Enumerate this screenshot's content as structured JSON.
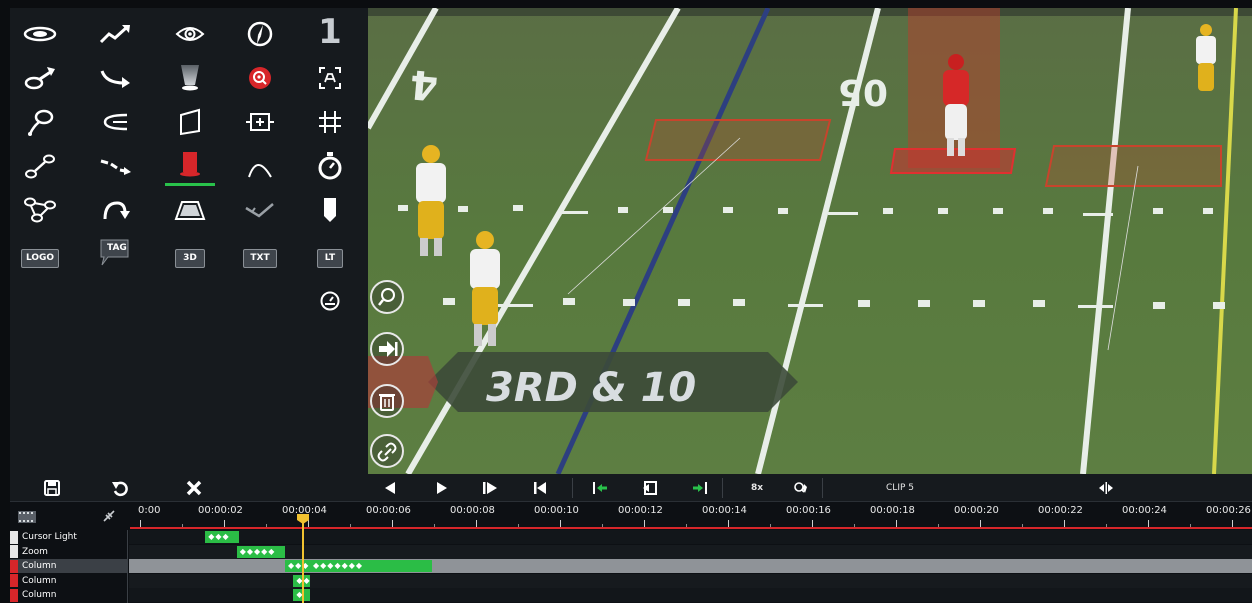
{
  "palette": {
    "tools": [
      {
        "name": "ellipse-spotlight-icon",
        "col": 0,
        "row": 0
      },
      {
        "name": "arrow-zigzag-icon",
        "col": 1,
        "row": 0
      },
      {
        "name": "eye-icon",
        "col": 2,
        "row": 0
      },
      {
        "name": "compass-icon",
        "col": 3,
        "row": 0
      },
      {
        "name": "number-one-icon",
        "col": 4,
        "row": 0
      },
      {
        "name": "ellipse-arrow-icon",
        "col": 0,
        "row": 1
      },
      {
        "name": "curved-arrow-icon",
        "col": 1,
        "row": 1
      },
      {
        "name": "cone-light-icon",
        "col": 2,
        "row": 1
      },
      {
        "name": "target-zoom-icon",
        "col": 3,
        "row": 1
      },
      {
        "name": "focus-frame-icon",
        "col": 4,
        "row": 1
      },
      {
        "name": "pin-marker-icon",
        "col": 0,
        "row": 2
      },
      {
        "name": "backward-arrow-icon",
        "col": 1,
        "row": 2
      },
      {
        "name": "plane-icon",
        "col": 2,
        "row": 2
      },
      {
        "name": "zoom-box-icon",
        "col": 3,
        "row": 2
      },
      {
        "name": "grid-icon",
        "col": 4,
        "row": 2
      },
      {
        "name": "connector-icon",
        "col": 0,
        "row": 3
      },
      {
        "name": "dashed-arrow-icon",
        "col": 1,
        "row": 3
      },
      {
        "name": "column-highlight-icon",
        "col": 2,
        "row": 3
      },
      {
        "name": "curve-line-icon",
        "col": 3,
        "row": 3
      },
      {
        "name": "stopwatch-icon",
        "col": 4,
        "row": 3
      },
      {
        "name": "triangle-nodes-icon",
        "col": 0,
        "row": 4
      },
      {
        "name": "rotate-arrow-icon",
        "col": 1,
        "row": 4
      },
      {
        "name": "floor-zone-icon",
        "col": 2,
        "row": 4
      },
      {
        "name": "angle-icon",
        "col": 3,
        "row": 4
      },
      {
        "name": "bookmark-icon",
        "col": 4,
        "row": 4
      }
    ],
    "labels": {
      "logo": "LOGO",
      "tag": "TAG",
      "three_d": "3D",
      "txt": "TXT",
      "lt": "LT"
    },
    "number_tool": "1",
    "speedometer": "speedometer-icon",
    "active_tool": "column-highlight-icon",
    "active_color": "#29c24b"
  },
  "video": {
    "down_distance": "3RD & 10",
    "yard_number_left": "4",
    "yard_number_top": "05",
    "side_buttons": [
      "magnifier-icon",
      "next-icon",
      "trash-icon",
      "link-icon"
    ]
  },
  "controls": {
    "save": "save-icon",
    "undo": "undo-icon",
    "close": "close-icon",
    "speed": "8x",
    "clip_label": "CLIP 5"
  },
  "timeline": {
    "ticks": [
      "0:00",
      "00:00:02",
      "00:00:04",
      "00:00:06",
      "00:00:08",
      "00:00:10",
      "00:00:12",
      "00:00:14",
      "00:00:16",
      "00:00:18",
      "00:00:20",
      "00:00:22",
      "00:00:24",
      "00:00:26"
    ],
    "playhead_time": "00:00:04",
    "tracks": [
      {
        "label": "Cursor Light",
        "color": "#e8e8e8",
        "start_sec": 1.6,
        "end_sec": 2.4,
        "keys": "◆◆◆",
        "selected": false
      },
      {
        "label": "Zoom",
        "color": "#e8e8e8",
        "start_sec": 2.35,
        "end_sec": 3.5,
        "keys": "◆◆◆◆◆",
        "selected": false
      },
      {
        "label": "Column",
        "color": "#d7262a",
        "start_sec": 3.5,
        "end_sec": 7.0,
        "keys": "◆◆◆ ◆◆◆◆◆◆◆",
        "selected": true
      },
      {
        "label": "Column",
        "color": "#d7262a",
        "start_sec": 3.7,
        "end_sec": 4.1,
        "keys": "◆◆",
        "selected": false
      },
      {
        "label": "Column",
        "color": "#d7262a",
        "start_sec": 3.7,
        "end_sec": 4.1,
        "keys": "◆",
        "selected": false
      }
    ]
  }
}
